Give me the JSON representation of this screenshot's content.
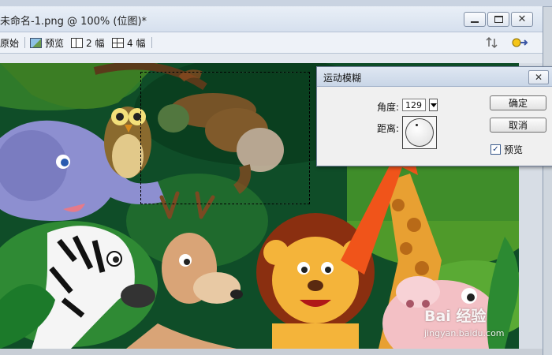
{
  "document": {
    "title": "未命名-1.png @ 100% (位图)*",
    "window_buttons": {
      "minimize": "minimize",
      "maximize": "maximize",
      "close": "close"
    }
  },
  "toolbar": {
    "original_label": "原始",
    "preview_label": "预览",
    "two_up_label": "2 幅",
    "four_up_label": "4 幅"
  },
  "dialog": {
    "title": "运动模糊",
    "close_label": "✕",
    "angle_label": "角度:",
    "angle_value": "129",
    "distance_label": "距离:",
    "ok_label": "确定",
    "cancel_label": "取消",
    "preview_label": "预览",
    "preview_checked": true
  },
  "watermark": {
    "brand": "Bai 经验",
    "url": "jingyan.baidu.com"
  },
  "colors": {
    "arrow": "#f0541a",
    "jungle": "#10502a",
    "selection": "#ffffff"
  }
}
